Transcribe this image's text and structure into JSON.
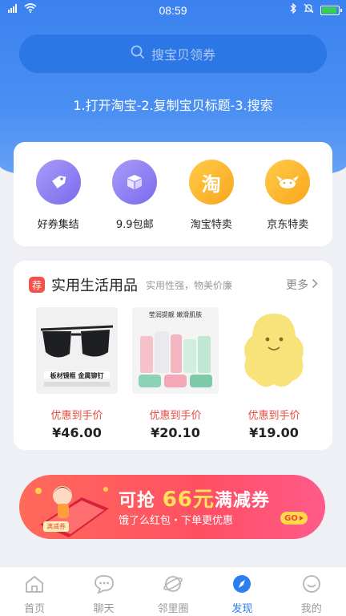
{
  "status_bar": {
    "time": "08:59"
  },
  "search": {
    "placeholder": "搜宝贝领券"
  },
  "steps_text": "1.打开淘宝-2.复制宝贝标题-3.搜索",
  "categories": [
    {
      "label": "好券集结",
      "icon": "tag-icon",
      "color": "#8b7cf2"
    },
    {
      "label": "9.9包邮",
      "icon": "box-icon",
      "color": "#8b7cf2"
    },
    {
      "label": "淘宝特卖",
      "icon": "taobao-icon",
      "icon_text": "淘",
      "color": "#fbb42a"
    },
    {
      "label": "京东特卖",
      "icon": "jd-dog-icon",
      "color": "#fbb42a"
    }
  ],
  "section": {
    "badge": "荐",
    "title": "实用生活用品",
    "subtitle": "实用性强，物美价廉",
    "more": "更多"
  },
  "products": [
    {
      "image": "sunglasses-image",
      "image_text": "板材镜框 金属铆钉",
      "note": "优惠到手价",
      "price": "¥46.00"
    },
    {
      "image": "skincare-set-image",
      "image_text": "莹润提靓 嫩滑肌肤",
      "note": "优惠到手价",
      "price": "¥20.10"
    },
    {
      "image": "yellow-sponge-image",
      "note": "优惠到手价",
      "price": "¥19.00"
    }
  ],
  "banner": {
    "prefix": "可抢",
    "amount": "66元",
    "suffix": "满减券",
    "subtitle": "饿了么红包・下单更优惠",
    "go": "GO",
    "tag": "满减券"
  },
  "tabs": [
    {
      "label": "首页",
      "icon": "home-icon",
      "active": false
    },
    {
      "label": "聊天",
      "icon": "chat-icon",
      "active": false
    },
    {
      "label": "邻里圈",
      "icon": "planet-icon",
      "active": false
    },
    {
      "label": "发现",
      "icon": "compass-icon",
      "active": true
    },
    {
      "label": "我的",
      "icon": "smile-face-icon",
      "active": false
    }
  ],
  "colors": {
    "primary": "#2a7ef0",
    "price_note": "#e9493f",
    "banner_red": "#ff4f63"
  }
}
